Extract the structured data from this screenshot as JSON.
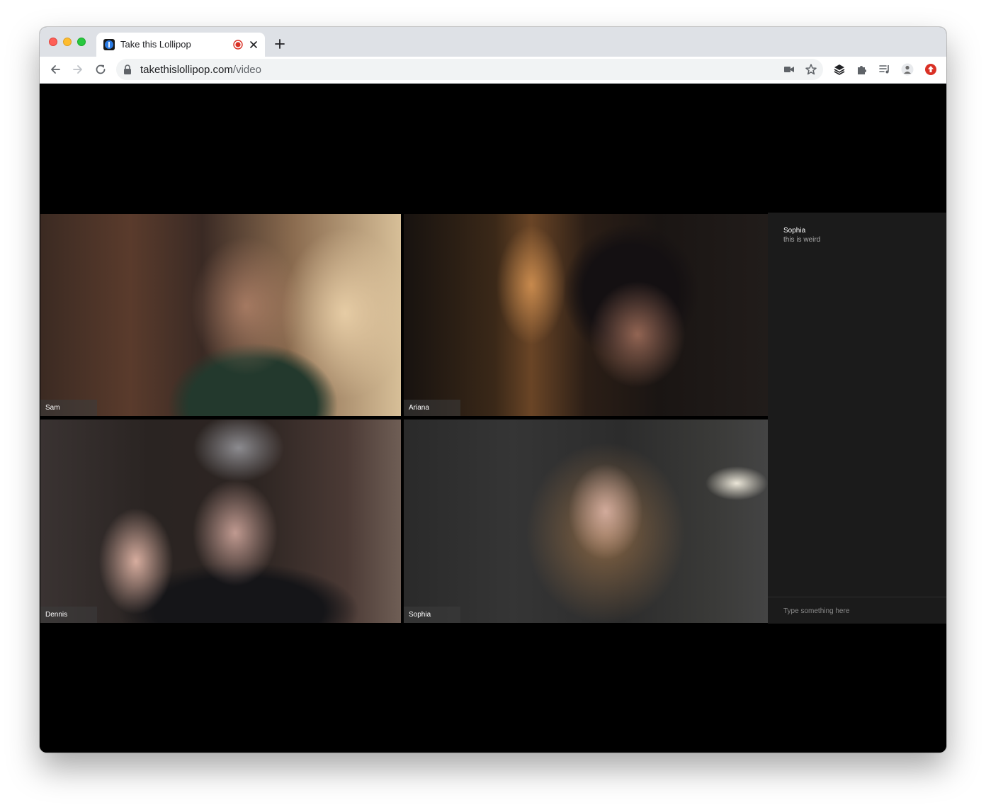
{
  "browser": {
    "tab": {
      "title": "Take this Lollipop"
    },
    "url": {
      "host": "takethislollipop.com",
      "path": "/video"
    }
  },
  "participants": [
    {
      "name": "Sam"
    },
    {
      "name": "Ariana"
    },
    {
      "name": "Dennis"
    },
    {
      "name": "Sophia"
    }
  ],
  "chat": {
    "messages": [
      {
        "author": "Sophia",
        "text": "this is weird"
      }
    ],
    "input_placeholder": "Type something here"
  },
  "colors": {
    "tabstrip": "#dee1e6",
    "record_indicator": "#d93025",
    "chat_panel": "#1b1b1b",
    "update_badge": "#d93025"
  }
}
